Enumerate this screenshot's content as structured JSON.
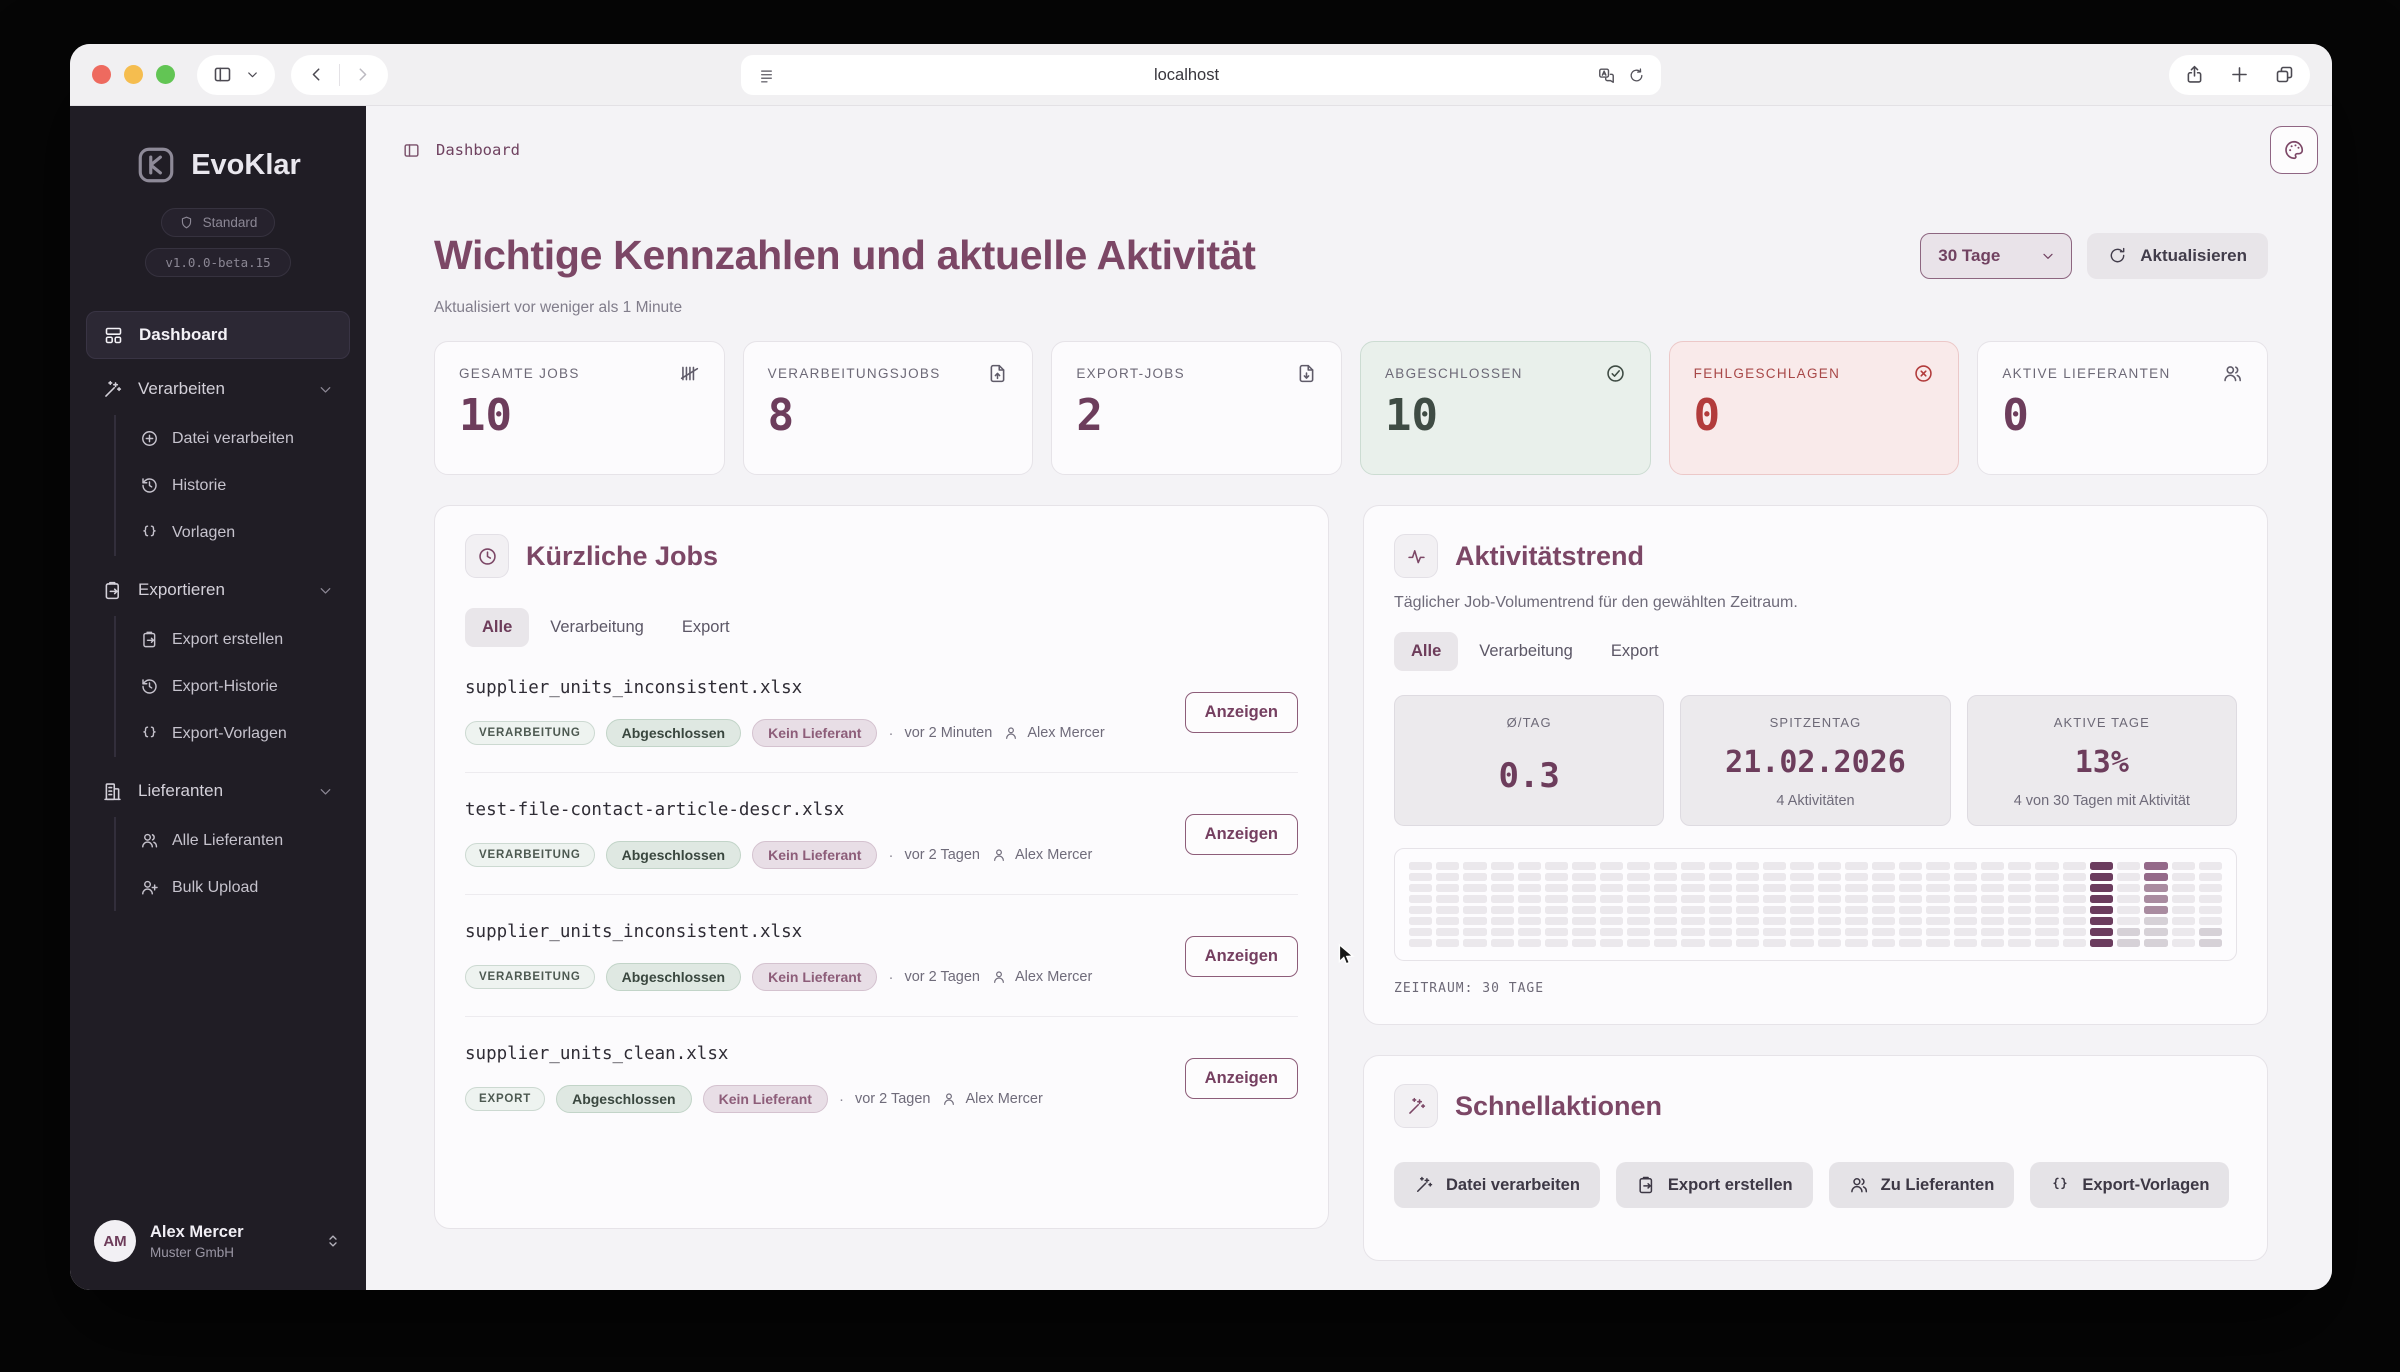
{
  "browser": {
    "url": "localhost",
    "traffic_lights": {
      "close": "#ee6a5f",
      "minimize": "#f5bd4f",
      "zoom": "#62c554"
    }
  },
  "sidebar": {
    "brand": "EvoKlar",
    "plan_badge": "Standard",
    "version_badge": "v1.0.0-beta.15",
    "nav": [
      {
        "label": "Dashboard",
        "icon": "dashboard-icon",
        "active": true
      },
      {
        "label": "Verarbeiten",
        "icon": "wand-icon",
        "children": [
          {
            "label": "Datei verarbeiten",
            "icon": "circle-plus-icon"
          },
          {
            "label": "Historie",
            "icon": "history-icon"
          },
          {
            "label": "Vorlagen",
            "icon": "braces-icon"
          }
        ]
      },
      {
        "label": "Exportieren",
        "icon": "clipboard-export-icon",
        "children": [
          {
            "label": "Export erstellen",
            "icon": "clipboard-export-icon"
          },
          {
            "label": "Export-Historie",
            "icon": "history-icon"
          },
          {
            "label": "Export-Vorlagen",
            "icon": "braces-icon"
          }
        ]
      },
      {
        "label": "Lieferanten",
        "icon": "building-icon",
        "children": [
          {
            "label": "Alle Lieferanten",
            "icon": "users-icon"
          },
          {
            "label": "Bulk Upload",
            "icon": "user-plus-icon"
          }
        ]
      }
    ],
    "user": {
      "initials": "AM",
      "name": "Alex Mercer",
      "org": "Muster GmbH"
    }
  },
  "header": {
    "breadcrumb": "Dashboard",
    "title": "Wichtige Kennzahlen und aktuelle Aktivität",
    "updated": "Aktualisiert vor weniger als 1 Minute",
    "range_value": "30 Tage",
    "refresh_label": "Aktualisieren"
  },
  "stats": [
    {
      "label": "GESAMTE JOBS",
      "value": "10",
      "icon": "tally-icon",
      "variant": "default"
    },
    {
      "label": "VERARBEITUNGSJOBS",
      "value": "8",
      "icon": "file-up-icon",
      "variant": "default"
    },
    {
      "label": "EXPORT-JOBS",
      "value": "2",
      "icon": "file-down-icon",
      "variant": "default"
    },
    {
      "label": "ABGESCHLOSSEN",
      "value": "10",
      "icon": "check-circle-icon",
      "variant": "success"
    },
    {
      "label": "FEHLGESCHLAGEN",
      "value": "0",
      "icon": "x-circle-icon",
      "variant": "danger"
    },
    {
      "label": "AKTIVE LIEFERANTEN",
      "value": "0",
      "icon": "users-icon",
      "variant": "default"
    }
  ],
  "recent_jobs": {
    "title": "Kürzliche Jobs",
    "icon": "clock-icon",
    "tabs": [
      "Alle",
      "Verarbeitung",
      "Export"
    ],
    "active_tab": "Alle",
    "view_label": "Anzeigen",
    "jobs": [
      {
        "file": "supplier_units_inconsistent.xlsx",
        "type": "VERARBEITUNG",
        "status": "Abgeschlossen",
        "supplier": "Kein Lieferant",
        "time": "vor 2 Minuten",
        "user": "Alex Mercer"
      },
      {
        "file": "test-file-contact-article-descr.xlsx",
        "type": "VERARBEITUNG",
        "status": "Abgeschlossen",
        "supplier": "Kein Lieferant",
        "time": "vor 2 Tagen",
        "user": "Alex Mercer"
      },
      {
        "file": "supplier_units_inconsistent.xlsx",
        "type": "VERARBEITUNG",
        "status": "Abgeschlossen",
        "supplier": "Kein Lieferant",
        "time": "vor 2 Tagen",
        "user": "Alex Mercer"
      },
      {
        "file": "supplier_units_clean.xlsx",
        "type": "EXPORT",
        "status": "Abgeschlossen",
        "supplier": "Kein Lieferant",
        "time": "vor 2 Tagen",
        "user": "Alex Mercer"
      }
    ]
  },
  "activity": {
    "title": "Aktivitätstrend",
    "icon": "activity-icon",
    "subtitle": "Täglicher Job-Volumentrend für den gewählten Zeitraum.",
    "tabs": [
      "Alle",
      "Verarbeitung",
      "Export"
    ],
    "active_tab": "Alle",
    "stats": [
      {
        "label": "Ø/TAG",
        "value": "0.3",
        "sub": ""
      },
      {
        "label": "SPITZENTAG",
        "value": "21.02.2026",
        "sub": "4 Aktivitäten"
      },
      {
        "label": "AKTIVE TAGE",
        "value": "13%",
        "sub": "4 von 30 Tagen mit Aktivität"
      }
    ],
    "footer": "ZEITRAUM: 30 TAGE",
    "chart_data": {
      "type": "heatmap",
      "days": 30,
      "rows": 8,
      "day_values": [
        0,
        0,
        0,
        0,
        0,
        0,
        0,
        0,
        0,
        0,
        0,
        0,
        0,
        0,
        0,
        0,
        0,
        0,
        0,
        0,
        0,
        0,
        0,
        0,
        0,
        4,
        1,
        2,
        0,
        1
      ],
      "colors": {
        "base": "#ebe8ec",
        "low": "#d6d1d7",
        "mid": "#946989",
        "mid_soft": "#a98ba0",
        "peak": "#6b3c5e"
      }
    }
  },
  "quick_actions": {
    "title": "Schnellaktionen",
    "icon": "wand-icon",
    "actions": [
      {
        "label": "Datei verarbeiten",
        "icon": "wand-icon"
      },
      {
        "label": "Export erstellen",
        "icon": "clipboard-export-icon"
      },
      {
        "label": "Zu Lieferanten",
        "icon": "users-icon"
      },
      {
        "label": "Export-Vorlagen",
        "icon": "braces-icon"
      }
    ]
  },
  "theme": {
    "accent": "#7c4766",
    "accent_deep": "#6d3d5c",
    "success": "#3f4c44",
    "danger": "#b23c3c",
    "sidebar_bg": "#201d25"
  }
}
